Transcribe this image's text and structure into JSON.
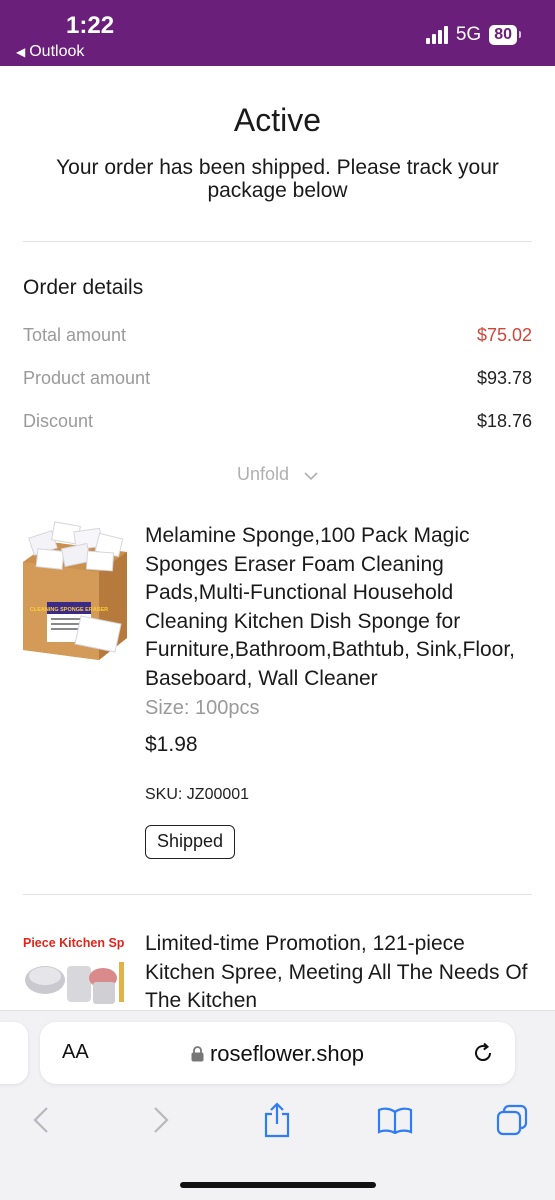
{
  "status_bar": {
    "time": "1:22",
    "back_app": "Outlook",
    "network": "5G",
    "battery": "80"
  },
  "header": {
    "title": "Active",
    "subtitle": "Your order has been shipped. Please track your package below"
  },
  "order_details": {
    "title": "Order details",
    "rows": [
      {
        "label": "Total amount",
        "value": "$75.02"
      },
      {
        "label": "Product amount",
        "value": "$93.78"
      },
      {
        "label": "Discount",
        "value": "$18.76"
      }
    ],
    "unfold_label": "Unfold"
  },
  "products": [
    {
      "title": "Melamine Sponge,100 Pack Magic Sponges Eraser Foam Cleaning Pads,Multi-Functional Household Cleaning Kitchen Dish Sponge for Furniture,Bathroom,Bathtub, Sink,Floor, Baseboard, Wall Cleaner",
      "size": "Size: 100pcs",
      "price": "$1.98",
      "sku": "SKU: JZ00001",
      "status": "Shipped",
      "image_text": "CLEANING SPONGE ERASER"
    },
    {
      "title": "Limited-time Promotion, 121-piece Kitchen Spree, Meeting All The Needs Of The Kitchen",
      "image_text": "Piece Kitchen Sp"
    }
  ],
  "browser": {
    "aa_label": "AA",
    "url": "roseflower.shop"
  },
  "colors": {
    "status_bar": "#6a1f7a",
    "total_amount": "#d0453a",
    "ios_blue": "#2f7cf6"
  }
}
